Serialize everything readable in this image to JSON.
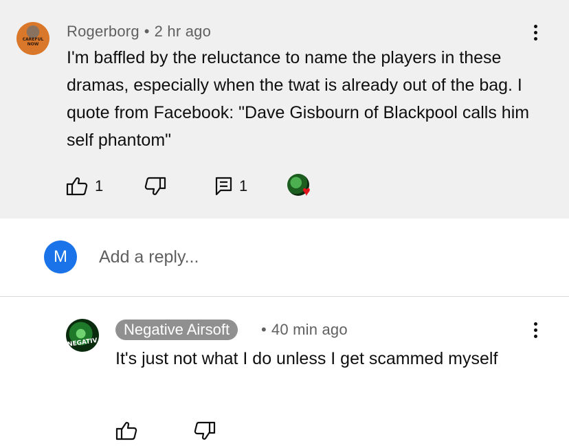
{
  "main_comment": {
    "author": "Rogerborg",
    "separator": "•",
    "time": "2 hr ago",
    "avatar_text": "CAREFUL NOW",
    "text": "I'm baffled by the reluctance to name the players in these dramas, especially when the twat is already out of the bag. I quote from Facebook: \"Dave Gisbourn of Blackpool calls him self phantom\"",
    "like_count": "1",
    "reply_count": "1",
    "creator_heart": true
  },
  "reply_box": {
    "avatar_letter": "M",
    "placeholder": "Add a reply..."
  },
  "reply_comment": {
    "author": "Negative Airsoft",
    "separator": "•",
    "time": "40 min ago",
    "avatar_text": "NEGATIV",
    "text": "It's just not what I do unless I get scammed myself"
  },
  "colors": {
    "highlight_bg": "#f0f0f0",
    "author_chip": "#909090",
    "avatar_me": "#1a73e8",
    "heart": "#e3141e"
  },
  "icons": {
    "like": "thumb-up-icon",
    "dislike": "thumb-down-icon",
    "reply": "comment-icon",
    "menu": "more-vert-icon"
  }
}
